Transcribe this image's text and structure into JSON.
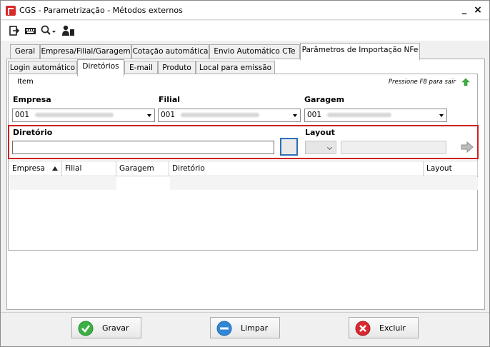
{
  "window": {
    "title": "CGS - Parametrização - Métodos externos",
    "minimize": "_",
    "close": "×"
  },
  "toolbar": {
    "icons": [
      "exit-icon",
      "keyboard-icon",
      "search-icon",
      "user-config-icon"
    ]
  },
  "main_tabs": [
    {
      "label": "Geral",
      "active": false
    },
    {
      "label": "Empresa/Filial/Garagem",
      "active": false
    },
    {
      "label": "Cotação automática",
      "active": false
    },
    {
      "label": "Envio Automático CTe",
      "active": false
    },
    {
      "label": "Parâmetros de Importação NFe",
      "active": true
    }
  ],
  "sub_tabs": [
    {
      "label": "Login automático",
      "active": false
    },
    {
      "label": "Diretórios",
      "active": true
    },
    {
      "label": "E-mail",
      "active": false
    },
    {
      "label": "Produto",
      "active": false
    },
    {
      "label": "Local para emissão",
      "active": false
    }
  ],
  "item_bar": {
    "label": "Item",
    "hint": "Pressione F8 para sair"
  },
  "form": {
    "empresa_label": "Empresa",
    "empresa_value": "001",
    "filial_label": "Filial",
    "filial_value": "001",
    "garagem_label": "Garagem",
    "garagem_value": "001",
    "diretorio_label": "Diretório",
    "diretorio_value": "",
    "layout_label": "Layout",
    "layout_value": ""
  },
  "grid": {
    "columns": [
      "Empresa",
      "Filial",
      "Garagem",
      "Diretório",
      "Layout"
    ]
  },
  "footer": {
    "gravar": "Gravar",
    "limpar": "Limpar",
    "excluir": "Excluir"
  },
  "colors": {
    "highlight": "#cc2121",
    "gravar": "#3cb043",
    "limpar": "#2f87d6",
    "excluir": "#d9282f"
  }
}
